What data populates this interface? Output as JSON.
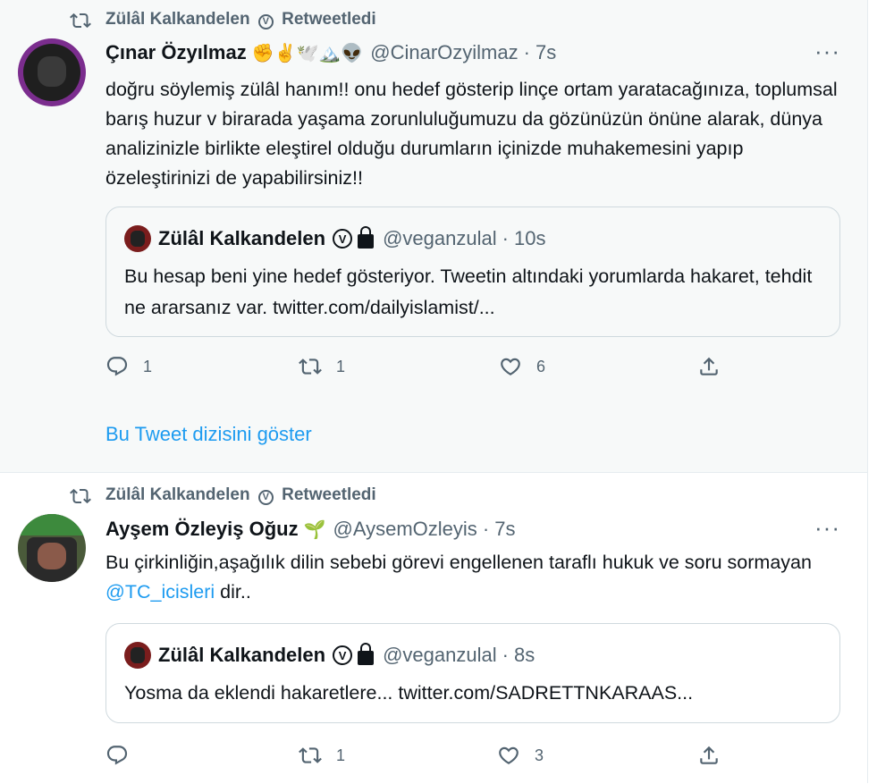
{
  "tweets": [
    {
      "retweet_by": "Zülâl Kalkandelen",
      "retweet_label": "Retweetledi",
      "author_name": "Çınar Özyılmaz",
      "author_emoji": "✊✌️🕊️🏔️👽",
      "author_handle": "@CinarOzyilmaz",
      "time": "· 7s",
      "text": "doğru söylemiş zülâl hanım!! onu hedef gösterip linçe ortam yaratacağınıza, toplumsal barış huzur v birarada yaşama zorunluluğumuzu da gözünüzün önüne alarak, dünya analizinizle birlikte eleştirel olduğu durumların içinizde muhakemesini yapıp özeleştirinizi de yapabilirsiniz!!",
      "quote": {
        "name": "Zülâl Kalkandelen",
        "handle": "@veganzulal",
        "time": "· 10s",
        "text": "Bu hesap beni yine hedef gösteriyor. Tweetin altındaki yorumlarda hakaret, tehdit ne ararsanız var. twitter.com/dailyislamist/..."
      },
      "replies": "1",
      "retweets": "1",
      "likes": "6",
      "show_thread": "Bu Tweet dizisini göster"
    },
    {
      "retweet_by": "Zülâl Kalkandelen",
      "retweet_label": "Retweetledi",
      "author_name": "Ayşem Özleyiş Oğuz",
      "author_emoji": "🌱",
      "author_handle": "@AysemOzleyis",
      "time": "· 7s",
      "text_before": "Bu çirkinliğin,aşağılık dilin sebebi görevi engellenen taraflı hukuk ve soru sormayan ",
      "mention": "@TC_icisleri",
      "text_after": " dir..",
      "quote": {
        "name": "Zülâl Kalkandelen",
        "handle": "@veganzulal",
        "time": "· 8s",
        "text": "Yosma da eklendi hakaretlere... twitter.com/SADRETTNKARAAS..."
      },
      "replies": "",
      "retweets": "1",
      "likes": "3"
    }
  ],
  "icons": [
    "retweet-icon",
    "reply-icon",
    "like-icon",
    "share-icon",
    "more-icon",
    "verified-icon",
    "lock-icon"
  ],
  "colors": {
    "link": "#1d9bf0",
    "muted": "#536471",
    "text": "#0f1419",
    "hover_bg": "#f7f9f9"
  }
}
